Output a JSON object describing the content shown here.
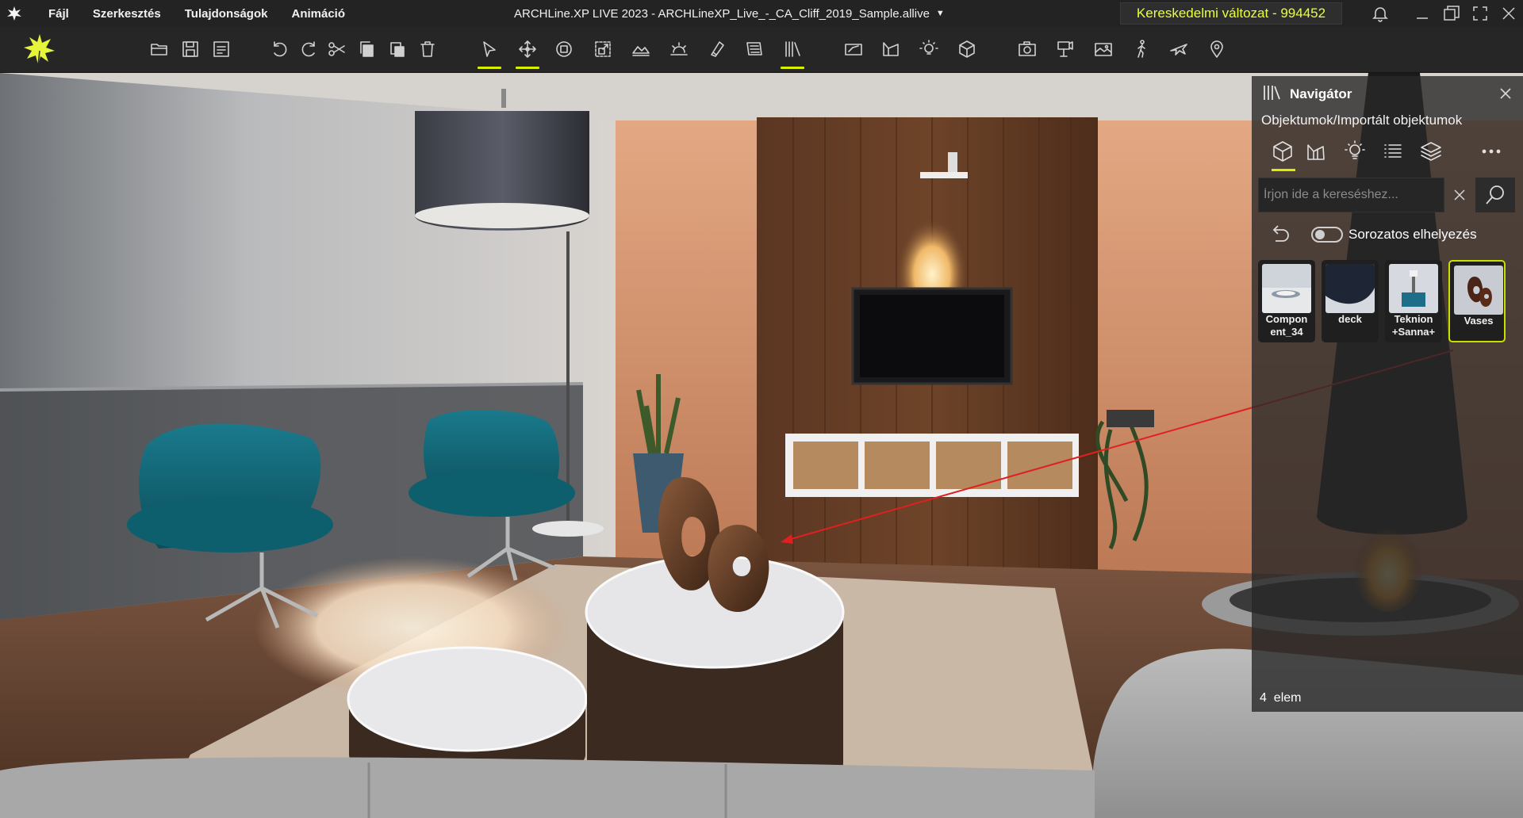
{
  "menubar": {
    "items": [
      {
        "label": "Fájl"
      },
      {
        "label": "Szerkesztés"
      },
      {
        "label": "Tulajdonságok"
      },
      {
        "label": "Animáció"
      }
    ],
    "title": "ARCHLine.XP LIVE 2023 - ARCHLineXP_Live_-_CA_Cliff_2019_Sample.allive",
    "license": "Kereskedelmi változat - 994452"
  },
  "toolbar": {
    "icons": [
      "open-folder-icon",
      "save-icon",
      "save-as-icon",
      "undo-icon",
      "redo-icon",
      "cut-icon",
      "copy-icon",
      "paste-icon",
      "delete-icon",
      "select-icon",
      "move-icon",
      "rotate-icon",
      "scale-icon",
      "terrain-icon",
      "sun-icon",
      "material-icon",
      "style-icon",
      "library-icon",
      "draw-icon",
      "surface-icon",
      "light-icon",
      "box-icon",
      "camera-icon",
      "video-icon",
      "render-icon",
      "walk-icon",
      "fly-icon",
      "location-icon"
    ],
    "active": [
      "select-icon",
      "move-icon",
      "library-icon"
    ]
  },
  "navigator": {
    "title": "Navigátor",
    "path": "Objektumok/Importált objektumok",
    "tabs": [
      "objects-tab",
      "materials-tab",
      "lights-tab",
      "list-tab",
      "layers-tab"
    ],
    "active_tab": "objects-tab",
    "search": {
      "placeholder": "Írjon ide a kereséshez..."
    },
    "toggle_label": "Sorozatos elhelyezés",
    "toggle_on": false,
    "items": [
      {
        "label": "Compon ent_34"
      },
      {
        "label": "deck"
      },
      {
        "label": "Teknion +Sanna+"
      },
      {
        "label": "Vases",
        "selected": true
      }
    ],
    "count": "4",
    "count_unit": "elem"
  },
  "colors": {
    "accent": "#d8f000",
    "license_text": "#e8ff3a",
    "selection_border": "#c8e000",
    "arrow": "#e02020"
  }
}
